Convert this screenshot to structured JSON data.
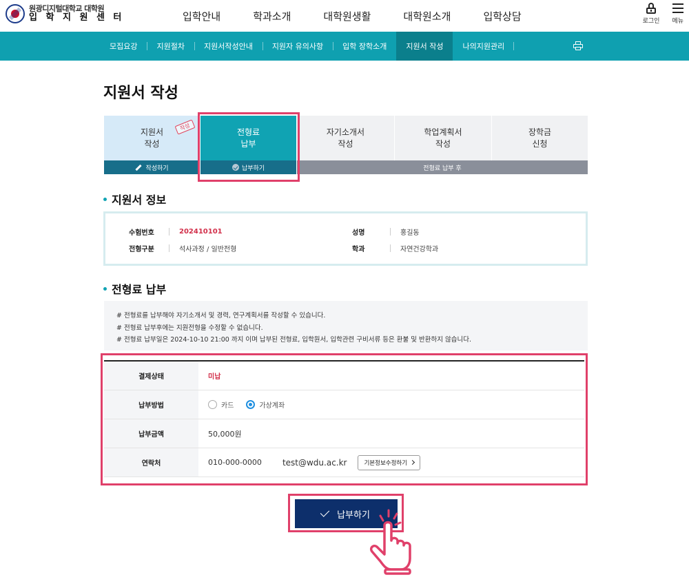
{
  "header": {
    "logo": {
      "line1": "원광디지털대학교 대학원",
      "line2": "입 학 지 원 센 터"
    },
    "gnb": [
      "입학안내",
      "학과소개",
      "대학원생활",
      "대학원소개",
      "입학상담"
    ],
    "login_label": "로그인",
    "menu_label": "메뉴"
  },
  "subnav": {
    "items": [
      "모집요강",
      "지원절차",
      "지원서작성안내",
      "지원자 유의사항",
      "입학 장학소개",
      "지원서 작성",
      "나의지원관리"
    ],
    "active_index": 5
  },
  "page_title": "지원서 작성",
  "steps": {
    "items": [
      "지원서\n작성",
      "전형료\n납부",
      "자기소개서\n작성",
      "학업계획서\n작성",
      "장학금\n신청"
    ],
    "stamp": "작성",
    "bar_done": "작성하기",
    "bar_current": "납부하기",
    "bar_after": "전형료 납부 후"
  },
  "info": {
    "title": "지원서 정보",
    "exam_no_label": "수험번호",
    "exam_no": "202410101",
    "name_label": "성명",
    "name": "홍길동",
    "type_label": "전형구분",
    "type": "석사과정 / 일반전형",
    "dept_label": "학과",
    "dept": "자연건강학과"
  },
  "payment": {
    "title": "전형료 납부",
    "notices": [
      "# 전형료를 납부해야 자기소개서 및 경력, 연구계획서를 작성할 수 있습니다.",
      "# 전형료 납부후에는 지원전형을 수정할 수 없습니다.",
      "# 전형료 납부일은 2024-10-10 21:00 까지 이며 납부된 전형료, 입학원서, 입학관련 구비서류 등은 환불 및 반환하지 않습니다."
    ],
    "status_label": "결제상태",
    "status": "미납",
    "method_label": "납부방법",
    "method_card": "카드",
    "method_account": "가상계좌",
    "selected_method": "가상계좌",
    "amount_label": "납부금액",
    "amount": "50,000원",
    "contact_label": "연락처",
    "phone": "010-000-0000",
    "email": "test@wdu.ac.kr",
    "edit_button": "기본정보수정하기"
  },
  "submit_label": "납부하기",
  "colors": {
    "teal": "#0fa0b0",
    "navy": "#0d2f6b",
    "highlight": "#e0406a",
    "status_red": "#d22f4a"
  }
}
